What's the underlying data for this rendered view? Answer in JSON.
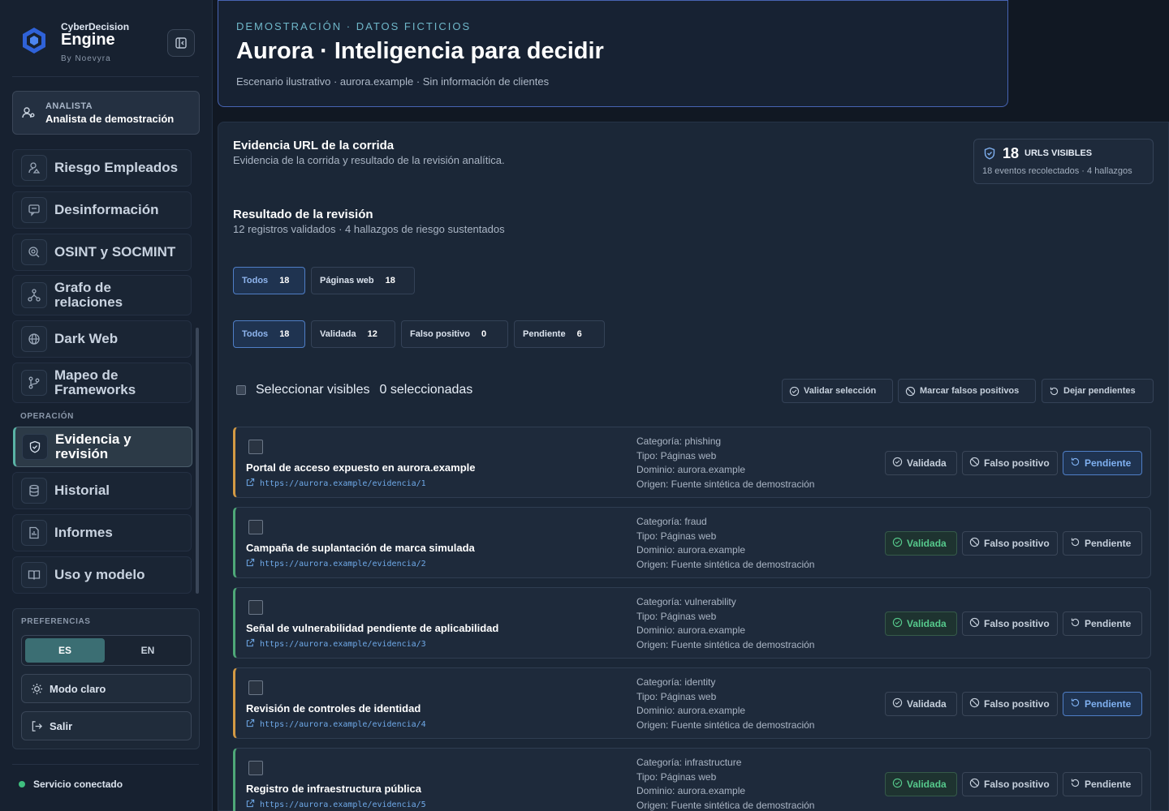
{
  "brand": {
    "small": "CyberDecision",
    "big": "Engine",
    "by": "By Noevyra"
  },
  "analyst": {
    "role": "ANALISTA",
    "name": "Analista de demostración"
  },
  "nav": [
    {
      "label": "Riesgo Empleados",
      "icon": "user-risk-icon"
    },
    {
      "label": "Desinformación",
      "icon": "message-icon"
    },
    {
      "label": "OSINT y SOCMINT",
      "icon": "search-zoom-icon"
    },
    {
      "label": "Grafo de relaciones",
      "icon": "graph-icon"
    },
    {
      "label": "Dark Web",
      "icon": "globe-icon"
    },
    {
      "label": "Mapeo de Frameworks",
      "icon": "branch-icon"
    }
  ],
  "operation_label": "OPERACIÓN",
  "operation_nav": [
    {
      "label": "Evidencia y revisión",
      "icon": "shield-icon",
      "active": true
    },
    {
      "label": "Historial",
      "icon": "database-icon"
    },
    {
      "label": "Informes",
      "icon": "report-icon"
    },
    {
      "label": "Uso y modelo",
      "icon": "book-icon"
    }
  ],
  "prefs": {
    "label": "PREFERENCIAS",
    "lang_es": "ES",
    "lang_en": "EN",
    "light_mode": "Modo claro",
    "logout": "Salir"
  },
  "status": "Servicio conectado",
  "header": {
    "eyebrow": "DEMOSTRACIÓN · DATOS FICTICIOS",
    "title": "Aurora · Inteligencia para decidir",
    "subtitle": "Escenario ilustrativo · aurora.example · Sin información de clientes"
  },
  "evidence": {
    "title": "Evidencia URL de la corrida",
    "subtitle": "Evidencia de la corrida y resultado de la revisión analítica.",
    "stat_num": "18",
    "stat_label": "URLS VISIBLES",
    "stat_sub": "18 eventos recolectados · 4 hallazgos"
  },
  "review": {
    "title": "Resultado de la revisión",
    "subtitle": "12 registros validados · 4 hallazgos de riesgo sustentados"
  },
  "type_filters": [
    {
      "label": "Todos",
      "count": "18",
      "active": true
    },
    {
      "label": "Páginas web",
      "count": "18",
      "active": false
    }
  ],
  "status_filters": [
    {
      "label": "Todos",
      "count": "18",
      "active": true
    },
    {
      "label": "Validada",
      "count": "12",
      "active": false
    },
    {
      "label": "Falso positivo",
      "count": "0",
      "active": false
    },
    {
      "label": "Pendiente",
      "count": "6",
      "active": false
    }
  ],
  "selection": {
    "select_visible": "Seleccionar visibles",
    "selected_count": "0 seleccionadas",
    "validate": "Validar selección",
    "mark_fp": "Marcar falsos positivos",
    "leave_pending": "Dejar pendientes"
  },
  "actions": {
    "validated": "Validada",
    "false_positive": "Falso positivo",
    "pending": "Pendiente"
  },
  "rows": [
    {
      "title": "Portal de acceso expuesto en aurora.example",
      "url": "https://aurora.example/evidencia/1",
      "category": "Categoría: phishing",
      "type": "Tipo: Páginas web",
      "domain": "Dominio: aurora.example",
      "origin": "Origen: Fuente sintética de demostración",
      "status": "pending",
      "accent": "#d39a44"
    },
    {
      "title": "Campaña de suplantación de marca simulada",
      "url": "https://aurora.example/evidencia/2",
      "category": "Categoría: fraud",
      "type": "Tipo: Páginas web",
      "domain": "Dominio: aurora.example",
      "origin": "Origen: Fuente sintética de demostración",
      "status": "validated",
      "accent": "#4ea878"
    },
    {
      "title": "Señal de vulnerabilidad pendiente de aplicabilidad",
      "url": "https://aurora.example/evidencia/3",
      "category": "Categoría: vulnerability",
      "type": "Tipo: Páginas web",
      "domain": "Dominio: aurora.example",
      "origin": "Origen: Fuente sintética de demostración",
      "status": "validated",
      "accent": "#4ea878"
    },
    {
      "title": "Revisión de controles de identidad",
      "url": "https://aurora.example/evidencia/4",
      "category": "Categoría: identity",
      "type": "Tipo: Páginas web",
      "domain": "Dominio: aurora.example",
      "origin": "Origen: Fuente sintética de demostración",
      "status": "pending",
      "accent": "#d39a44"
    },
    {
      "title": "Registro de infraestructura pública",
      "url": "https://aurora.example/evidencia/5",
      "category": "Categoría: infrastructure",
      "type": "Tipo: Páginas web",
      "domain": "Dominio: aurora.example",
      "origin": "Origen: Fuente sintética de demostración",
      "status": "validated",
      "accent": "#4ea878"
    }
  ]
}
